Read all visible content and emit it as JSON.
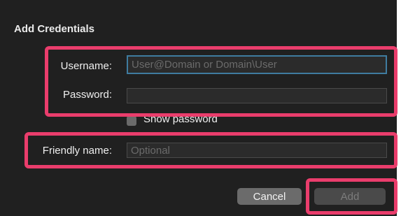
{
  "dialog": {
    "title": "Add Credentials"
  },
  "form": {
    "username": {
      "label": "Username:",
      "placeholder": "User@Domain or Domain\\User",
      "value": ""
    },
    "password": {
      "label": "Password:",
      "value": ""
    },
    "show_password": {
      "label": "Show password",
      "checked": false
    },
    "friendly_name": {
      "label": "Friendly name:",
      "placeholder": "Optional",
      "value": ""
    }
  },
  "buttons": {
    "cancel_label": "Cancel",
    "add_label": "Add",
    "add_enabled": false
  },
  "colors": {
    "dialog_background": "#202020",
    "highlight": "#ea3d6c",
    "focus_ring": "#3f7ca0"
  }
}
